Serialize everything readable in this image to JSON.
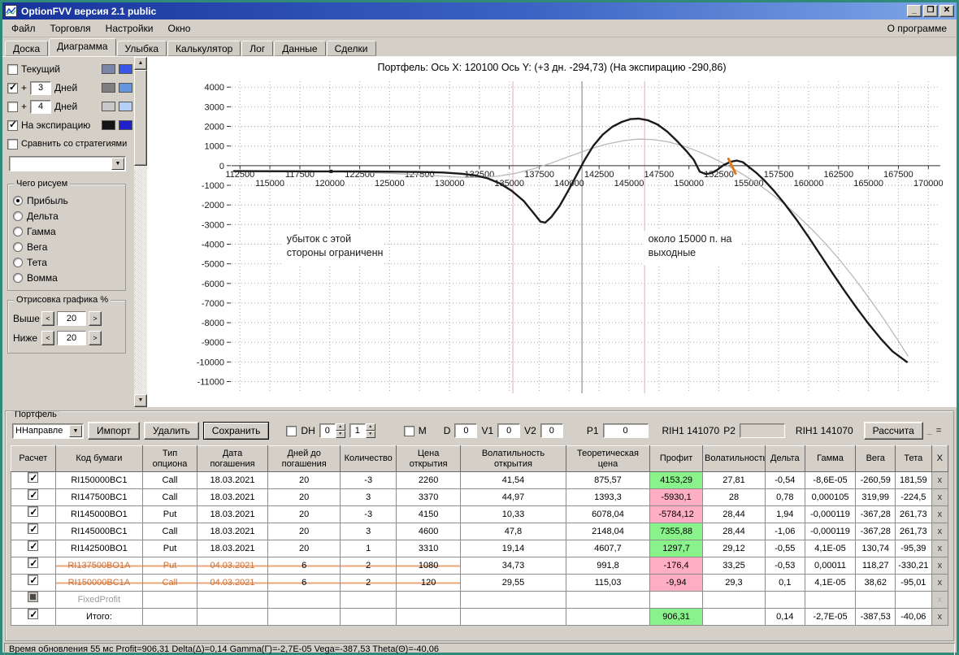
{
  "window": {
    "title": "OptionFVV версия 2.1 public",
    "border_color": "#2f8a7a"
  },
  "icons": {
    "minimize": "_",
    "maximize": "❐",
    "close": "✕",
    "dropdown": "▼",
    "spin_up": "▲",
    "spin_down": "▼",
    "spin_left": "<",
    "spin_right": ">",
    "scroll_up": "▲",
    "scroll_down": "▼",
    "delete_x": "x",
    "mdi_restore": "="
  },
  "colors": {
    "profit_positive": "#8af28a",
    "profit_negative": "#ffaec4",
    "closed_row_text": "#c87137",
    "annotation_orange": "#e07818",
    "titlebar_gradient": [
      "#18339b",
      "#7fa7e8"
    ]
  },
  "menu": {
    "items": [
      "Файл",
      "Торговля",
      "Настройки",
      "Окно"
    ],
    "right": "О программе"
  },
  "tabs": {
    "items": [
      "Доска",
      "Диаграмма",
      "Улыбка",
      "Калькулятор",
      "Лог",
      "Данные",
      "Сделки"
    ],
    "active": "Диаграмма"
  },
  "left_panel": {
    "rows": [
      {
        "label": "Текущий",
        "checked": false,
        "swatches": [
          "#7a86a8",
          "#3b55e6"
        ]
      },
      {
        "label": "Дней",
        "prefix": "+",
        "value": "3",
        "checked": true,
        "swatches": [
          "#7f7f7f",
          "#6395e0"
        ]
      },
      {
        "label": "Дней",
        "prefix": "+",
        "value": "4",
        "checked": false,
        "swatches": [
          "#c8c8c8",
          "#b4d0f8"
        ]
      },
      {
        "label": "На экспирацию",
        "checked": true,
        "swatches": [
          "#141414",
          "#2020cc"
        ]
      },
      {
        "label": "Сравнить со стратегиями",
        "checked": false
      }
    ],
    "strategy_select": "",
    "draw_group": {
      "title": "Чего рисуем",
      "options": [
        "Прибыль",
        "Дельта",
        "Гамма",
        "Вега",
        "Тета",
        "Вомма"
      ],
      "selected": "Прибыль"
    },
    "render_group": {
      "title": "Отрисовка графика %",
      "above_label": "Выше",
      "above_value": "20",
      "below_label": "Ниже",
      "below_value": "20"
    }
  },
  "chart": {
    "title": "Портфель:  Ось X: 120100 Ось Y:   (+3 дн. -294,73)  (На экспирацию -290,86)"
  },
  "chart_data": {
    "type": "line",
    "title": "Портфель:  Ось X: 120100 Ось Y:   (+3 дн. -294,73)  (На экспирацию -290,86)",
    "x_range": [
      111800,
      171000
    ],
    "y_range": [
      -11600,
      4300
    ],
    "y_ticks": {
      "max": 4000,
      "min": -11000,
      "step": 1000
    },
    "x_ticks": {
      "start": 112500,
      "end": 170000,
      "step": 2500
    },
    "grid": true,
    "legend_position": "none",
    "series": [
      {
        "name": "+3 дней",
        "color": "#b9b9b9",
        "width": 1.3,
        "points": [
          [
            112000,
            -295
          ],
          [
            115000,
            -300
          ],
          [
            117500,
            -300
          ],
          [
            120100,
            -295
          ],
          [
            122500,
            -330
          ],
          [
            125000,
            -390
          ],
          [
            127500,
            -460
          ],
          [
            129500,
            -540
          ],
          [
            131000,
            -590
          ],
          [
            132500,
            -600
          ],
          [
            134000,
            -540
          ],
          [
            135500,
            -390
          ],
          [
            137000,
            -160
          ],
          [
            138500,
            130
          ],
          [
            140000,
            470
          ],
          [
            141500,
            800
          ],
          [
            143000,
            1080
          ],
          [
            144500,
            1270
          ],
          [
            145700,
            1350
          ],
          [
            147000,
            1330
          ],
          [
            148200,
            1220
          ],
          [
            149400,
            1030
          ],
          [
            150600,
            770
          ],
          [
            151800,
            450
          ],
          [
            153000,
            80
          ],
          [
            154200,
            -330
          ],
          [
            155400,
            -790
          ],
          [
            156600,
            -1300
          ],
          [
            157800,
            -1870
          ],
          [
            159000,
            -2500
          ],
          [
            160200,
            -3200
          ],
          [
            161400,
            -3970
          ],
          [
            162600,
            -4810
          ],
          [
            163800,
            -5720
          ],
          [
            165000,
            -6700
          ],
          [
            166200,
            -7740
          ],
          [
            167400,
            -8840
          ],
          [
            168300,
            -9700
          ]
        ]
      },
      {
        "name": "На экспирацию",
        "color": "#1b1b1b",
        "width": 2.4,
        "points": [
          [
            112000,
            -280
          ],
          [
            114500,
            -285
          ],
          [
            117000,
            -288
          ],
          [
            119000,
            -290
          ],
          [
            120100,
            -291
          ],
          [
            122500,
            -296
          ],
          [
            125000,
            -305
          ],
          [
            127500,
            -320
          ],
          [
            129500,
            -350
          ],
          [
            131000,
            -410
          ],
          [
            132200,
            -500
          ],
          [
            133200,
            -650
          ],
          [
            134200,
            -900
          ],
          [
            135200,
            -1280
          ],
          [
            136200,
            -1800
          ],
          [
            137000,
            -2400
          ],
          [
            137600,
            -2850
          ],
          [
            138000,
            -2900
          ],
          [
            138500,
            -2620
          ],
          [
            139200,
            -2050
          ],
          [
            139900,
            -1300
          ],
          [
            140600,
            -500
          ],
          [
            141300,
            300
          ],
          [
            142000,
            1000
          ],
          [
            142800,
            1580
          ],
          [
            143600,
            1980
          ],
          [
            144400,
            2230
          ],
          [
            145100,
            2370
          ],
          [
            145800,
            2400
          ],
          [
            146600,
            2310
          ],
          [
            147400,
            2090
          ],
          [
            148200,
            1730
          ],
          [
            149000,
            1260
          ],
          [
            149800,
            740
          ],
          [
            150400,
            300
          ],
          [
            150900,
            -300
          ],
          [
            151400,
            -430
          ],
          [
            151900,
            -380
          ],
          [
            152400,
            -200
          ],
          [
            152900,
            30
          ],
          [
            153500,
            200
          ],
          [
            154000,
            260
          ],
          [
            154500,
            180
          ],
          [
            155000,
            -60
          ],
          [
            155600,
            -350
          ],
          [
            156300,
            -750
          ],
          [
            157100,
            -1280
          ],
          [
            158000,
            -1950
          ],
          [
            159000,
            -2760
          ],
          [
            160000,
            -3640
          ],
          [
            161000,
            -4560
          ],
          [
            162000,
            -5480
          ],
          [
            163000,
            -6380
          ],
          [
            164000,
            -7240
          ],
          [
            165000,
            -8050
          ],
          [
            166000,
            -8800
          ],
          [
            167000,
            -9460
          ],
          [
            168200,
            -10000
          ]
        ]
      }
    ],
    "vlines": [
      {
        "x": 135300,
        "color": "#efb6bf"
      },
      {
        "x": 141070,
        "color": "#8e9399"
      },
      {
        "x": 146300,
        "color": "#efb6bf"
      }
    ],
    "marker": {
      "x": 120100,
      "y": -291,
      "color": "#1b1b1b"
    },
    "orange_tick": {
      "x1": 153300,
      "y1": 350,
      "x2": 153900,
      "y2": -400,
      "color": "#e07818"
    },
    "annotations": [
      {
        "x": 116400,
        "y": -3900,
        "color": "#e07818",
        "lines": [
          "убыток с этой",
          "стороны ограниченн"
        ]
      },
      {
        "x": 146600,
        "y": -3900,
        "color": "#e07818",
        "lines": [
          "около 15000 п. на",
          "выходные"
        ]
      }
    ]
  },
  "portfolio": {
    "group_title": "Портфель",
    "toolbar": {
      "direction_select": "ННаправле",
      "import": "Импорт",
      "delete": "Удалить",
      "save": "Сохранить",
      "dh_label": "DH",
      "dh_spin1": "0",
      "dh_spin2": "1",
      "m_label": "М",
      "d_label": "D",
      "d_value": "0",
      "v1_label": "V1",
      "v1_value": "0",
      "v2_label": "V2",
      "v2_value": "0",
      "p1_label": "P1",
      "p1_value": "0",
      "rih1_label": "RIH1 141070",
      "p2_label": "P2",
      "p2_value": "",
      "rih2_label": "RIH1 141070",
      "calc": "Рассчита"
    },
    "table": {
      "headers": [
        "Расчет",
        "Код бумаги",
        "Тип опциона",
        "Дата погашения",
        "Дней до погашения",
        "Количество",
        "Цена открытия",
        "Волатильность открытия",
        "Теоретическая цена",
        "Профит",
        "Волатильность",
        "Дельта",
        "Гамма",
        "Вега",
        "Тета",
        "X"
      ],
      "rows": [
        {
          "check": "on",
          "style": "normal",
          "code": "RI150000BC1",
          "type": "Call",
          "date": "18.03.2021",
          "days": "20",
          "qty": "-3",
          "open": "2260",
          "ovol": "41,54",
          "theo": "875,57",
          "profit": "4153,29",
          "pstate": "pos",
          "vol": "27,81",
          "delta": "-0,54",
          "gamma": "-8,6E-05",
          "vega": "-260,59",
          "theta": "181,59"
        },
        {
          "check": "on",
          "style": "normal",
          "code": "RI147500BC1",
          "type": "Call",
          "date": "18.03.2021",
          "days": "20",
          "qty": "3",
          "open": "3370",
          "ovol": "44,97",
          "theo": "1393,3",
          "profit": "-5930,1",
          "pstate": "neg",
          "vol": "28",
          "delta": "0,78",
          "gamma": "0,000105",
          "vega": "319,99",
          "theta": "-224,5"
        },
        {
          "check": "on",
          "style": "normal",
          "code": "RI145000BO1",
          "type": "Put",
          "date": "18.03.2021",
          "days": "20",
          "qty": "-3",
          "open": "4150",
          "ovol": "10,33",
          "theo": "6078,04",
          "profit": "-5784,12",
          "pstate": "neg",
          "vol": "28,44",
          "delta": "1,94",
          "gamma": "-0,000119",
          "vega": "-367,28",
          "theta": "261,73"
        },
        {
          "check": "on",
          "style": "normal",
          "code": "RI145000BC1",
          "type": "Call",
          "date": "18.03.2021",
          "days": "20",
          "qty": "3",
          "open": "4600",
          "ovol": "47,8",
          "theo": "2148,04",
          "profit": "7355,88",
          "pstate": "pos",
          "vol": "28,44",
          "delta": "-1,06",
          "gamma": "-0,000119",
          "vega": "-367,28",
          "theta": "261,73"
        },
        {
          "check": "on",
          "style": "normal",
          "code": "RI142500BO1",
          "type": "Put",
          "date": "18.03.2021",
          "days": "20",
          "qty": "1",
          "open": "3310",
          "ovol": "19,14",
          "theo": "4607,7",
          "profit": "1297,7",
          "pstate": "pos",
          "vol": "29,12",
          "delta": "-0,55",
          "gamma": "4,1E-05",
          "vega": "130,74",
          "theta": "-95,39"
        },
        {
          "check": "on",
          "style": "closed",
          "code": "RI137500BO1A",
          "type": "Put",
          "date": "04.03.2021",
          "days": "6",
          "qty": "2",
          "open": "1080",
          "ovol": "34,73",
          "theo": "991,8",
          "profit": "-176,4",
          "pstate": "neg",
          "vol": "33,25",
          "delta": "-0,53",
          "gamma": "0,00011",
          "vega": "118,27",
          "theta": "-330,21"
        },
        {
          "check": "on",
          "style": "closed",
          "code": "RI150000BC1A",
          "type": "Call",
          "date": "04.03.2021",
          "days": "6",
          "qty": "2",
          "open": "120",
          "ovol": "29,55",
          "theo": "115,03",
          "profit": "-9,94",
          "pstate": "neg",
          "vol": "29,3",
          "delta": "0,1",
          "gamma": "4,1E-05",
          "vega": "38,62",
          "theta": "-95,01"
        },
        {
          "check": "filled",
          "style": "disabled",
          "code": "FixedProfit",
          "type": "",
          "date": "",
          "days": "",
          "qty": "",
          "open": "",
          "ovol": "",
          "theo": "",
          "profit": "",
          "pstate": "",
          "vol": "",
          "delta": "",
          "gamma": "",
          "vega": "",
          "theta": ""
        },
        {
          "check": "on",
          "style": "total",
          "code": "Итого:",
          "type": "",
          "date": "",
          "days": "",
          "qty": "",
          "open": "",
          "ovol": "",
          "theo": "",
          "profit": "906,31",
          "pstate": "pos",
          "vol": "",
          "delta": "0,14",
          "gamma": "-2,7E-05",
          "vega": "-387,53",
          "theta": "-40,06"
        }
      ]
    }
  },
  "status_bar": "Время обновления 55 мс   Profit=906,31  Delta(Δ)=0,14  Gamma(Г)=-2,7E-05  Vega=-387,53  Theta(Θ)=-40,06"
}
